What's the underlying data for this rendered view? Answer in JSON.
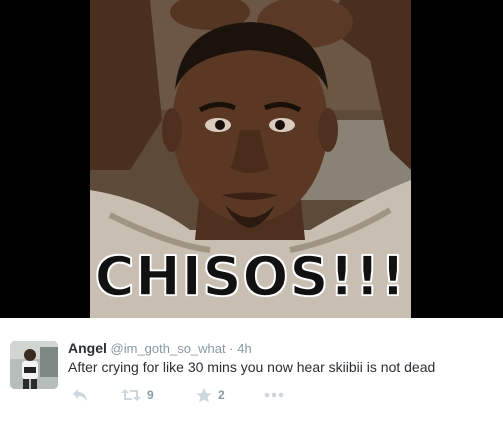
{
  "media": {
    "caption": "CHISOS!!!"
  },
  "tweet": {
    "author_name": "Angel",
    "handle": "@im_goth_so_what",
    "separator": "·",
    "time": "4h",
    "text": "After crying for like 30 mins you now hear skiibii is not dead",
    "actions": {
      "reply_icon": "reply-icon",
      "retweet_icon": "retweet-icon",
      "retweet_count": "9",
      "favorite_icon": "star-icon",
      "favorite_count": "2",
      "more_icon": "more-dots-icon"
    }
  },
  "colors": {
    "text": "#292f33",
    "secondary": "#8899a6",
    "background": "#ffffff",
    "media_background": "#000000"
  }
}
